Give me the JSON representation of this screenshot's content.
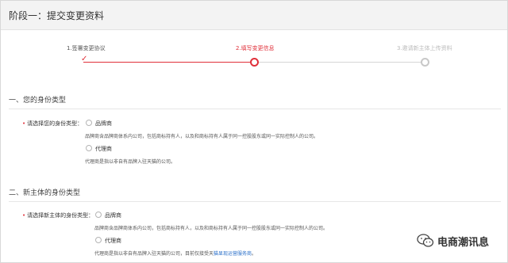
{
  "header": {
    "title": "阶段一：提交变更资料"
  },
  "stepper": {
    "steps": [
      {
        "label": "1.签署变更协议",
        "state": "done"
      },
      {
        "label": "2.填写变更信息",
        "state": "current"
      },
      {
        "label": "3.邀请新主体上传资料",
        "state": "pending"
      }
    ],
    "active_color": "#e0303a"
  },
  "section1": {
    "title": "一、您的身份类型",
    "field_label": "请选择您的身份类型：",
    "options": [
      {
        "label": "品牌商",
        "desc": "品牌商含品牌商体系内公司，包括商标持有人，以及和商标持有人属于同一控股股东或同一实际控制人的公司。"
      },
      {
        "label": "代理商",
        "desc": "代理商是指以非自有品牌入驻天猫的公司。"
      }
    ]
  },
  "section2": {
    "title": "二、新主体的身份类型",
    "field_label": "请选择新主体的身份类型：",
    "options": [
      {
        "label": "品牌商",
        "desc": "品牌商含品牌商体系内公司，包括商标持有人，以及和商标持有人属于同一控股股东或同一实际控制人的公司。"
      },
      {
        "label": "代理商",
        "desc_prefix": "代理商是指以非自有品牌入驻天猫的公司，目前仅接受天",
        "desc_link": "猫显现运营服务商",
        "desc_suffix": "。"
      }
    ]
  },
  "watermark": {
    "text": "电商潮讯息",
    "icon": "wechat-icon"
  }
}
